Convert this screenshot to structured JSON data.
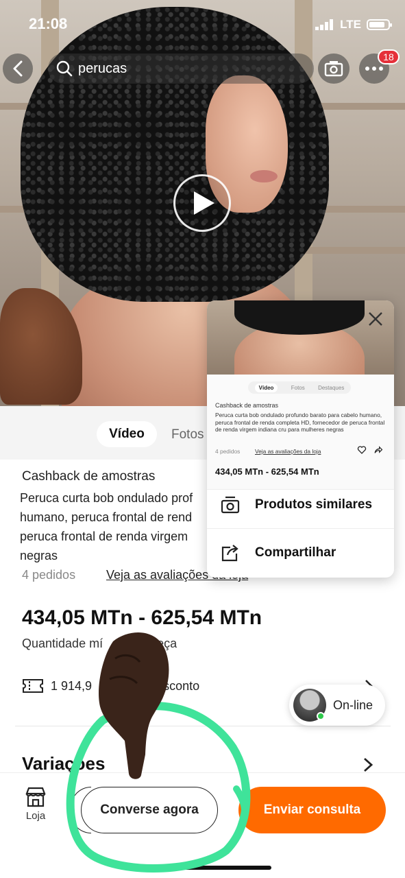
{
  "status_bar": {
    "time": "21:08",
    "network": "LTE"
  },
  "header": {
    "search_query": "perucas",
    "cart_badge": "18"
  },
  "media_tabs": {
    "video": "Vídeo",
    "photos": "Fotos"
  },
  "product": {
    "cashback": "Cashback de amostras",
    "title": "Peruca curta bob ondulado profundo barato para cabelo humano, peruca frontal de renda completa HD, fornecedor de peruca frontal de renda virgem indiana cru para mulheres negras",
    "title_visible": "Peruca curta bob ondulado prof\nhumano, peruca frontal de rend\nperuca frontal de renda virgem\nnegras",
    "orders": "4 pedidos",
    "reviews_link": "Veja as avaliações da loja",
    "price": "434,05 MTn - 625,54 MTn",
    "min_qty_visible": "Quantidade mí",
    "min_qty_unit": "Peça",
    "coupon_amount": "1 914,9",
    "coupon_suffix": "esconto",
    "variations": "Variações"
  },
  "popup": {
    "mini_tabs": [
      "Vídeo",
      "Fotos",
      "Destaques"
    ],
    "cashback": "Cashback de amostras",
    "title": "Peruca curta bob ondulado profundo barato para cabelo humano, peruca frontal de renda completa HD, fornecedor de peruca frontal de renda virgem indiana cru para mulheres negras",
    "orders": "4 pedidos",
    "reviews_link": "Veja as avaliações da loja",
    "price": "434,05 MTn - 625,54 MTn",
    "menu": {
      "similar": "Produtos similares",
      "share": "Compartilhar"
    }
  },
  "online_chip": {
    "label": "On-line"
  },
  "bottom_bar": {
    "store": "Loja",
    "chat": "Converse agora",
    "inquiry": "Enviar consulta"
  },
  "colors": {
    "accent": "#ff6a00",
    "badge": "#e5303a",
    "online": "#2ec94b",
    "annotation_circle": "#3fe39a"
  },
  "icons": [
    "back-arrow-icon",
    "search-icon",
    "camera-icon",
    "more-icon",
    "play-icon",
    "close-icon",
    "heart-icon",
    "share-icon",
    "similar-products-icon",
    "coupon-icon",
    "chevron-right-icon",
    "store-icon"
  ]
}
